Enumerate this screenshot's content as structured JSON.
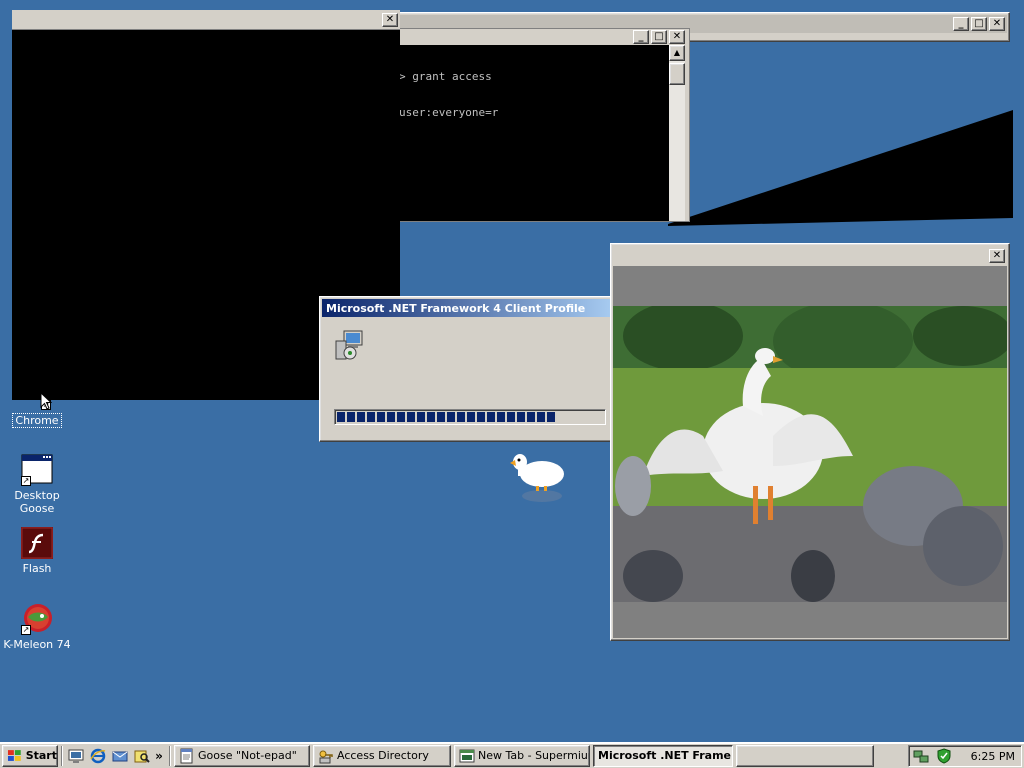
{
  "terminal": {
    "lines": [
      "> grant access",
      "user:everyone=r"
    ]
  },
  "desktop_icons": [
    {
      "label": "Chrome"
    },
    {
      "label": "Desktop Goose"
    },
    {
      "label": "Flash"
    },
    {
      "label": "K-Meleon 74"
    }
  ],
  "dialog": {
    "title": "Microsoft .NET Framework 4 Client Profile",
    "progress_fraction": 0.85
  },
  "taskbar": {
    "start_label": "Start",
    "quick_launch": [
      "show-desktop-icon",
      "ie-icon",
      "outlook-icon",
      "explorer-icon"
    ],
    "overflow": "»",
    "tasks": [
      {
        "label": "Goose \"Not-epad\"",
        "icon": "notepad-icon"
      },
      {
        "label": "Access Directory",
        "icon": "access-icon"
      },
      {
        "label": "New Tab - Supermium",
        "icon": "browser-icon"
      },
      {
        "label": "Microsoft .NET Frame...",
        "icon": "",
        "active": true
      }
    ],
    "clock": "6:25 PM"
  },
  "colors": {
    "desktop": "#3a6ea5",
    "title_active": "#0a246a",
    "progress": "#0a246a"
  }
}
